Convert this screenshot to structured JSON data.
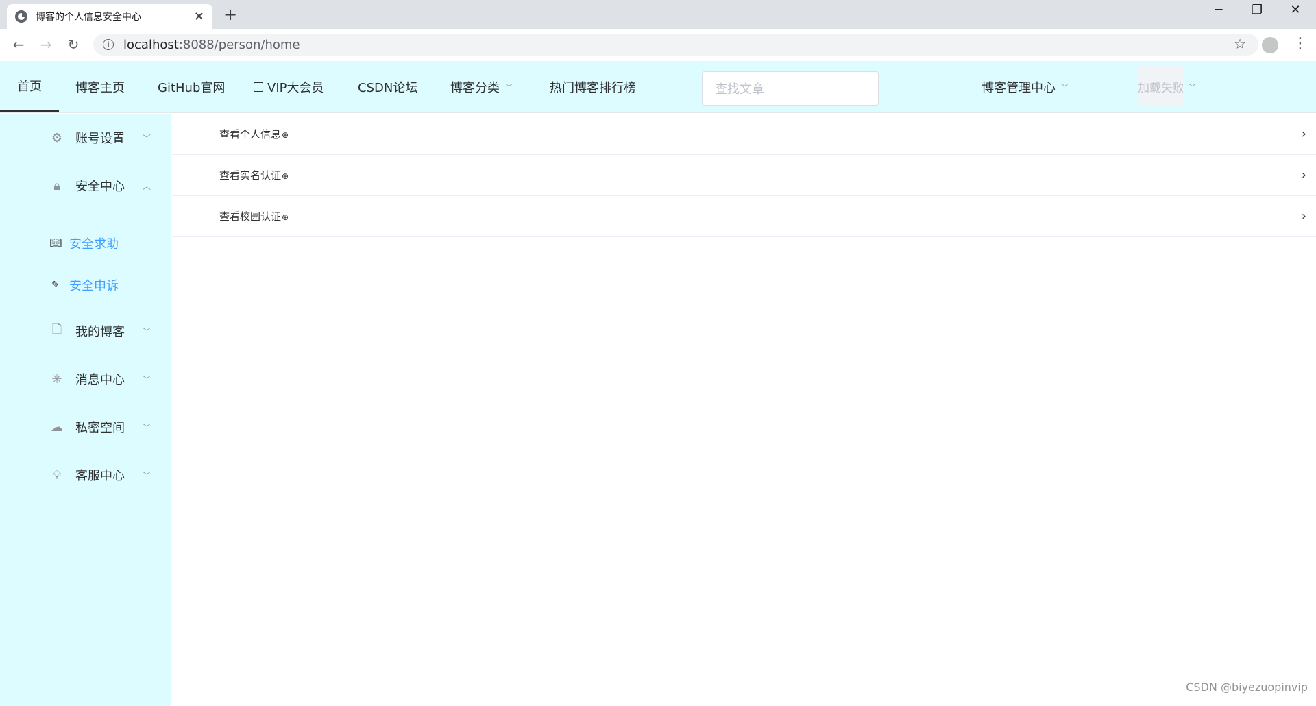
{
  "browser": {
    "tab_title": "博客的个人信息安全中心",
    "tab_close": "✕",
    "new_tab": "+",
    "url_host": "localhost",
    "url_path": ":8088/person/home",
    "window_controls": {
      "minimize": "─",
      "restore": "❐",
      "close": "✕"
    }
  },
  "header": {
    "nav": [
      {
        "label": "首页",
        "active": true
      },
      {
        "label": "博客主页"
      },
      {
        "label": "GitHub官网"
      },
      {
        "label": "VIP大会员",
        "icon": "vip-icon"
      },
      {
        "label": "CSDN论坛"
      },
      {
        "label": "博客分类",
        "dropdown": true
      },
      {
        "label": "热门博客排行榜"
      }
    ],
    "search_placeholder": "查找文章",
    "admin_center": "博客管理中心",
    "load_failed": "加载失败"
  },
  "sidebar": {
    "menus": [
      {
        "label": "账号设置",
        "icon": "gear-icon",
        "expanded": false
      },
      {
        "label": "安全中心",
        "icon": "lock-icon",
        "expanded": true
      },
      {
        "label": "我的博客",
        "icon": "document-add-icon",
        "expanded": false
      },
      {
        "label": "消息中心",
        "icon": "loading-icon",
        "expanded": false
      },
      {
        "label": "私密空间",
        "icon": "cloud-upload-icon",
        "expanded": false
      },
      {
        "label": "客服中心",
        "icon": "bulb-icon",
        "expanded": false
      }
    ],
    "security_submenu": [
      {
        "label": "安全求助",
        "icon": "book-icon"
      },
      {
        "label": "安全申诉",
        "icon": "edit-icon"
      }
    ]
  },
  "main": {
    "rows": [
      {
        "label": "查看个人信息"
      },
      {
        "label": "查看实名认证"
      },
      {
        "label": "查看校园认证"
      }
    ]
  },
  "watermark": "CSDN @biyezuopinvip"
}
